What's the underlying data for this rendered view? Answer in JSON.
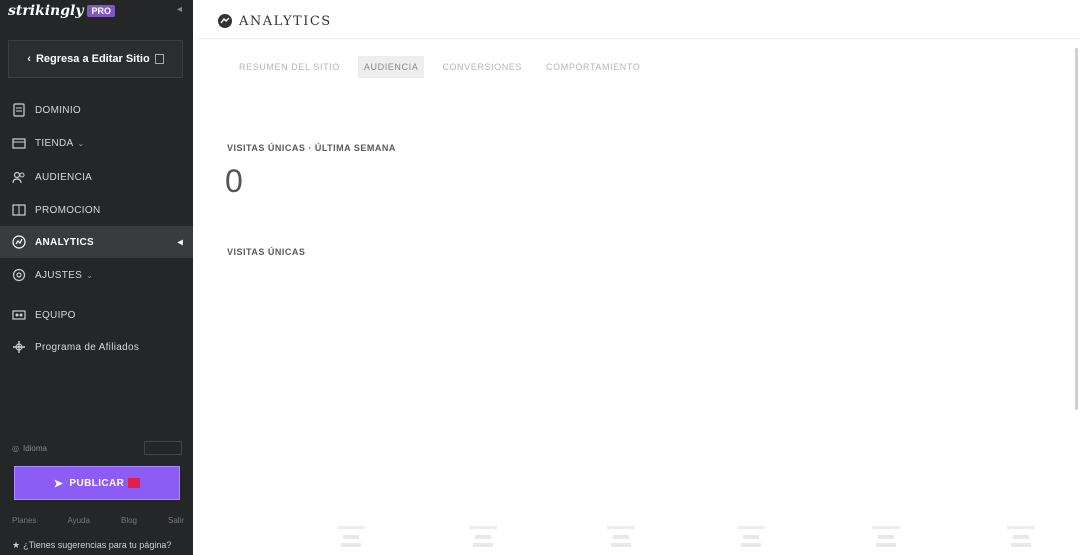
{
  "sidebar": {
    "brand": "strikingly",
    "badge": "PRO",
    "back_label": "Regresa a Editar Sitio",
    "nav": [
      {
        "label": "DOMINIO",
        "icon": "domain-icon"
      },
      {
        "label": "TIENDA",
        "icon": "store-icon"
      },
      {
        "label": "AUDIENCIA",
        "icon": "audience-icon"
      },
      {
        "label": "PROMOCION",
        "icon": "promotion-icon"
      },
      {
        "label": "ANALYTICS",
        "icon": "analytics-icon",
        "active": true
      },
      {
        "label": "AJUSTES",
        "icon": "settings-icon"
      },
      {
        "label": "EQUIPO",
        "icon": "team-icon"
      },
      {
        "label": "Programa de Afiliados",
        "icon": "affiliate-icon"
      }
    ],
    "footer_label": "Idioma",
    "publish_label": "PUBLICAR",
    "bottom_links": [
      "Planes",
      "Ayuda",
      "Blog",
      "Salir"
    ],
    "help_text": "¿Tienes sugerencias para tu página?"
  },
  "main": {
    "title": "ANALYTICS",
    "tabs": [
      {
        "label": "RESUMEN DEL SITIO"
      },
      {
        "label": "AUDIENCIA",
        "active": true
      },
      {
        "label": "CONVERSIONES"
      },
      {
        "label": "COMPORTAMIENTO"
      }
    ],
    "unique_week_label": "VISITAS ÚNICAS · ÚLTIMA SEMANA",
    "unique_week_value": "0",
    "unique_label": "VISITAS ÚNICAS"
  },
  "colors": {
    "sidebar_bg": "#252628",
    "active_bg": "#3a3b3f",
    "publish": "#8b5cf6",
    "badge": "#7e57c2"
  }
}
